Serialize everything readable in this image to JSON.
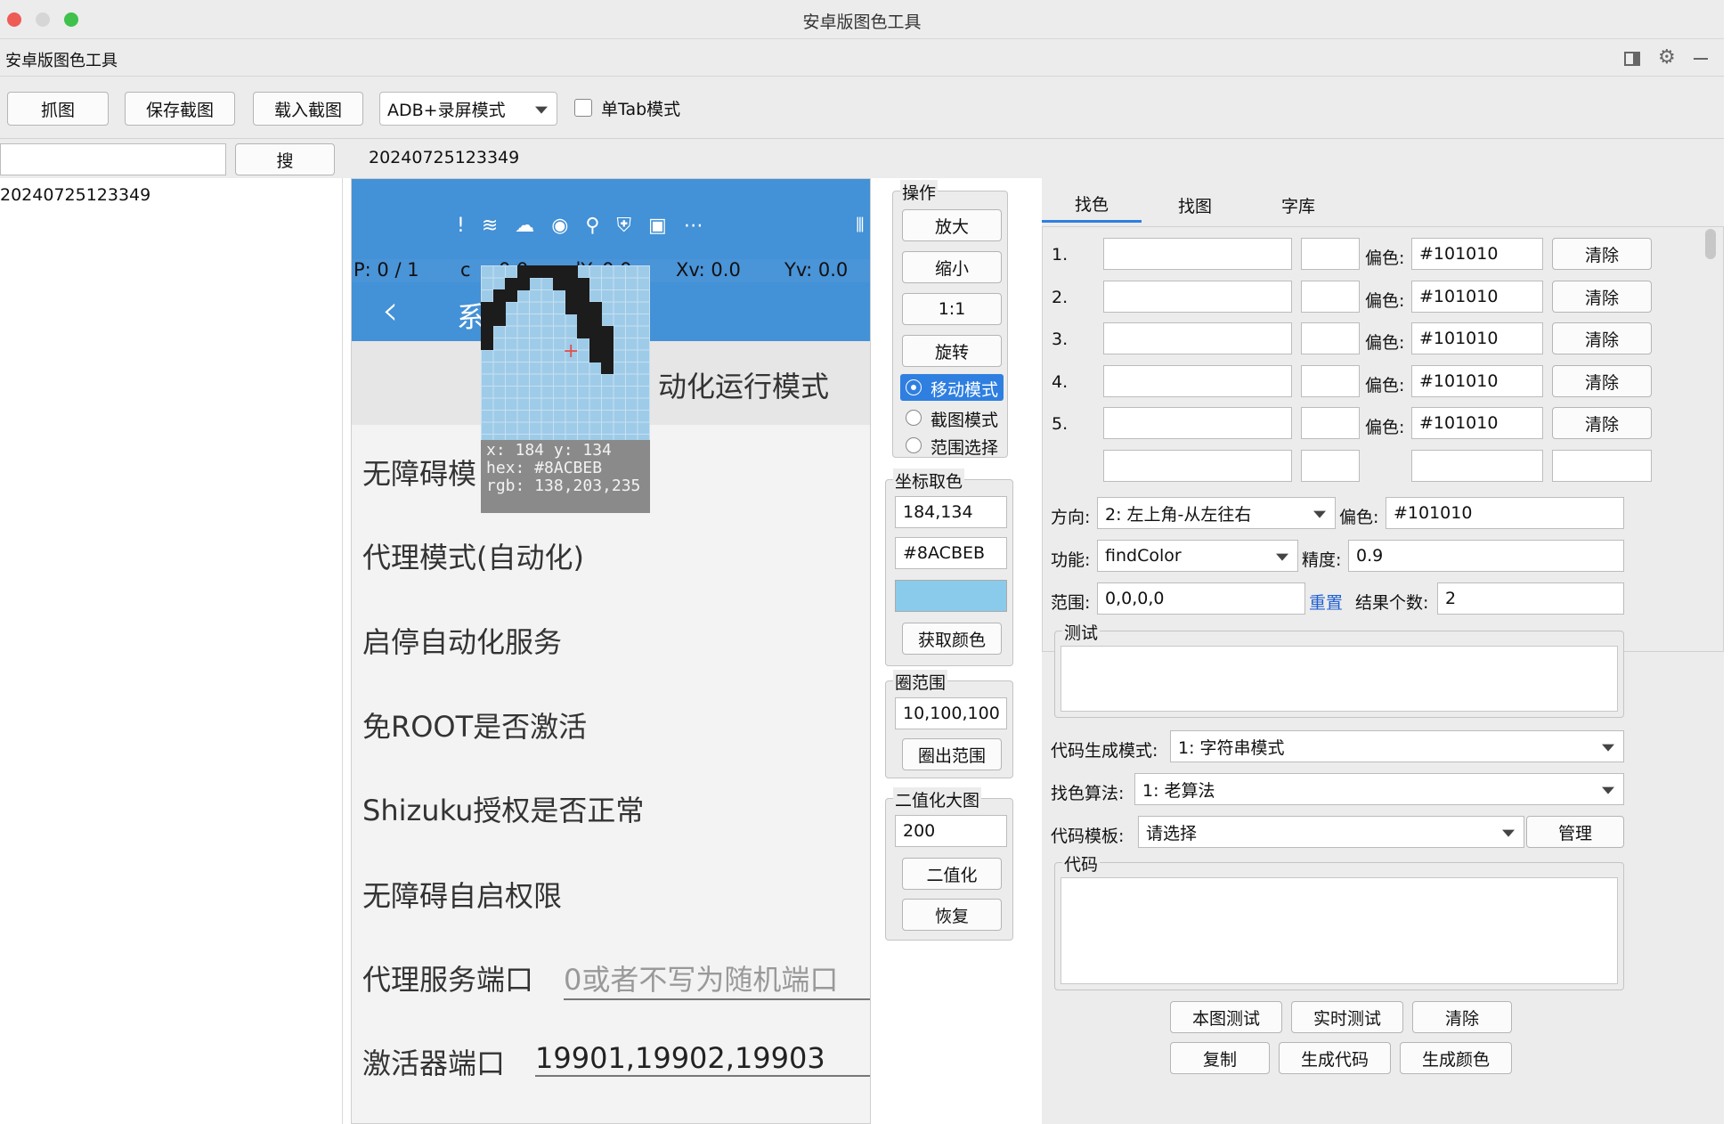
{
  "window": {
    "title": "安卓版图色工具"
  },
  "app": {
    "title": "安卓版图色工具"
  },
  "toolbar": {
    "capture": "抓图",
    "save": "保存截图",
    "load": "载入截图",
    "mode_select": "ADB+录屏模式",
    "single_tab": "单Tab模式"
  },
  "search": {
    "value": "",
    "button": "搜",
    "current_file": "20240725123349"
  },
  "file_list": [
    "20240725123349"
  ],
  "phone": {
    "coords": {
      "p": "P: 0 / 1",
      "c": "c",
      "c_val": "0.0",
      "dy": "dY: 0.0",
      "xv": "Xv: 0.0",
      "yv": "Yv: 0.0"
    },
    "title_partial": "系",
    "hint": "动化运行模式",
    "rows": [
      "无障碍模",
      "代理模式(自动化)",
      "启停自动化服务",
      "免ROOT是否激活",
      "Shizuku授权是否正常",
      "无障碍自启权限"
    ],
    "proxy_port_label": "代理服务端口",
    "proxy_port_placeholder": "0或者不写为随机端口",
    "activator_port_label": "激活器端口",
    "activator_port_value": "19901,19902,19903"
  },
  "magnifier": {
    "x_y": "x: 184 y: 134",
    "hex": "hex: #8ACBEB",
    "rgb": "rgb: 138,203,235"
  },
  "ops": {
    "label": "操作",
    "zoom_in": "放大",
    "zoom_out": "缩小",
    "one_to_one": "1:1",
    "rotate": "旋转",
    "mode_move": "移动模式",
    "mode_screenshot": "截图模式",
    "mode_range": "范围选择"
  },
  "coord_pick": {
    "label": "坐标取色",
    "coord": "184,134",
    "hex": "#8ACBEB",
    "swatch_color": "#8ACBEB",
    "get_color": "获取颜色"
  },
  "circle": {
    "label": "圈范围",
    "value": "10,100,100",
    "button": "圈出范围"
  },
  "binarize": {
    "label": "二值化大图",
    "value": "200",
    "button": "二值化",
    "restore": "恢复"
  },
  "tabs": [
    "找色",
    "找图",
    "字库"
  ],
  "color_rows": [
    {
      "num": "1.",
      "offset_label": "偏色:",
      "offset": "#101010",
      "clear": "清除"
    },
    {
      "num": "2.",
      "offset_label": "偏色:",
      "offset": "#101010",
      "clear": "清除"
    },
    {
      "num": "3.",
      "offset_label": "偏色:",
      "offset": "#101010",
      "clear": "清除"
    },
    {
      "num": "4.",
      "offset_label": "偏色:",
      "offset": "#101010",
      "clear": "清除"
    },
    {
      "num": "5.",
      "offset_label": "偏色:",
      "offset": "#101010",
      "clear": "清除"
    }
  ],
  "settings": {
    "direction_label": "方向:",
    "direction_value": "2: 左上角-从左往右",
    "offset_label": "偏色:",
    "offset_value": "#101010",
    "func_label": "功能:",
    "func_value": "findColor",
    "precision_label": "精度:",
    "precision_value": "0.9",
    "range_label": "范围:",
    "range_value": "0,0,0,0",
    "reset": "重置",
    "count_label": "结果个数:",
    "count_value": "2",
    "test_label": "测试",
    "codegen_label": "代码生成模式:",
    "codegen_value": "1: 字符串模式",
    "algo_label": "找色算法:",
    "algo_value": "1: 老算法",
    "template_label": "代码模板:",
    "template_value": "请选择",
    "manage": "管理",
    "code_label": "代码"
  },
  "actions": {
    "test_image": "本图测试",
    "realtime_test": "实时测试",
    "clear": "清除",
    "copy": "复制",
    "gen_code": "生成代码",
    "gen_color": "生成颜色"
  }
}
